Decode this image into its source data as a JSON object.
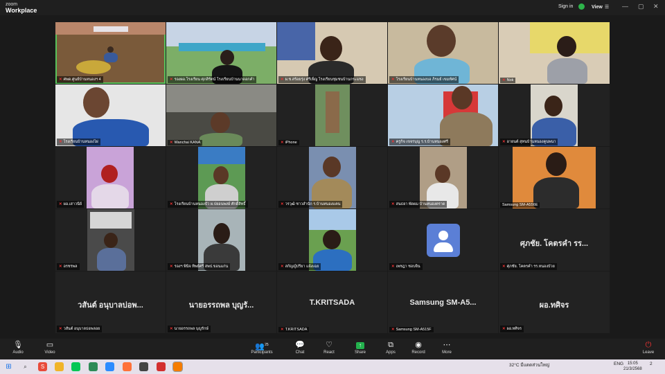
{
  "app": {
    "brand_line1": "zoom",
    "brand_line2": "Workplace",
    "signin": "Sign in",
    "view": "View",
    "win_min": "—",
    "win_max": "▢",
    "win_close": "✕"
  },
  "tiles": [
    {
      "label": "ศพด.ศูนย์บ้านหนองฯ 4",
      "big": ""
    },
    {
      "label": "รองผอ.โรงเรียน ศุภสิรัตน์ โรงเรียนบ้านนาดอกคำ",
      "big": ""
    },
    {
      "label": "ผ.ช.สร้อยรุ่ง ศรีเพ็ญ โรงเรียนชุมชนบ้านกระแชง",
      "big": ""
    },
    {
      "label": "โรงเรียนบ้านหนองบอ ภิรมย์ เขมทัศน์",
      "big": ""
    },
    {
      "label": "Nok",
      "big": ""
    },
    {
      "label": "โรงเรียนบ้านหนองไผ่",
      "big": ""
    },
    {
      "label": "Wanchai KANA",
      "big": ""
    },
    {
      "label": "iPhone",
      "big": ""
    },
    {
      "label": "ครูกิจ เขจรบุญ ร.ร.บ้านหนองศรี",
      "big": ""
    },
    {
      "label": "อายนต์ สุทนบ้านหนองคูนพนา",
      "big": ""
    },
    {
      "label": "ผอ.เสาวนีย์",
      "big": ""
    },
    {
      "label": "โรงเรียนบ้านหนองบัว ผ.ปยอนพงษ์ ศักดิ์สิทธิ์",
      "big": ""
    },
    {
      "label": "วรวุฒิ ชาวสำนัก ร.บ้านหนองแคน",
      "big": ""
    },
    {
      "label": "สนธยา พัดผม บ้านหนองตราด",
      "big": ""
    },
    {
      "label": "Samsung SM-A556E",
      "big": ""
    },
    {
      "label": "อรชรพล",
      "big": ""
    },
    {
      "label": "รองฯ พินิจ ทิพย์ศรี สพป.ขอนแก่น",
      "big": ""
    },
    {
      "label": "สกัญญ์ปรียา แจ้งเฉย",
      "big": ""
    },
    {
      "label": "เพชฎา ชอบจิน",
      "big": ""
    },
    {
      "label": "ศุภชัย. โคตรคำ รร.หนองบัวย",
      "big": "ศุภชัย. โคตรคำ รร..."
    },
    {
      "label": "วสันต์ อนุบาลบ่อพลอย",
      "big": "วสันต์ อนุบาลบ่อพ..."
    },
    {
      "label": "นายอรรถพล บุญรักษ์",
      "big": "นายอรรถพล บุญรั..."
    },
    {
      "label": "T.KRITSADA",
      "big": "T.KRITSADA"
    },
    {
      "label": "Samsung SM-A515F",
      "big": "Samsung  SM-A5..."
    },
    {
      "label": "ผอ.ทศิจร",
      "big": "ผอ.ทศิจร"
    }
  ],
  "toolbar": {
    "audio": "Audio",
    "video": "Video",
    "participants": "Participants",
    "participants_count": "25",
    "chat": "Chat",
    "react": "React",
    "share": "Share",
    "apps": "Apps",
    "record": "Record",
    "more": "More",
    "leave": "Leave"
  },
  "taskbar": {
    "weather": "32°C มีแดดส่วนใหญ่",
    "lang": "ENG",
    "time": "15:05",
    "date": "21/3/2568",
    "notif": "2"
  },
  "colors": {
    "active_border": "#58c35b",
    "mic_muted": "#e03333",
    "share_green": "#23b14d",
    "avatar_blue": "#5b7fd6"
  },
  "icons": [
    "mic-icon",
    "video-icon",
    "participants-icon",
    "chat-icon",
    "react-icon",
    "share-icon",
    "apps-icon",
    "record-icon",
    "more-icon",
    "leave-icon",
    "shield-icon"
  ]
}
